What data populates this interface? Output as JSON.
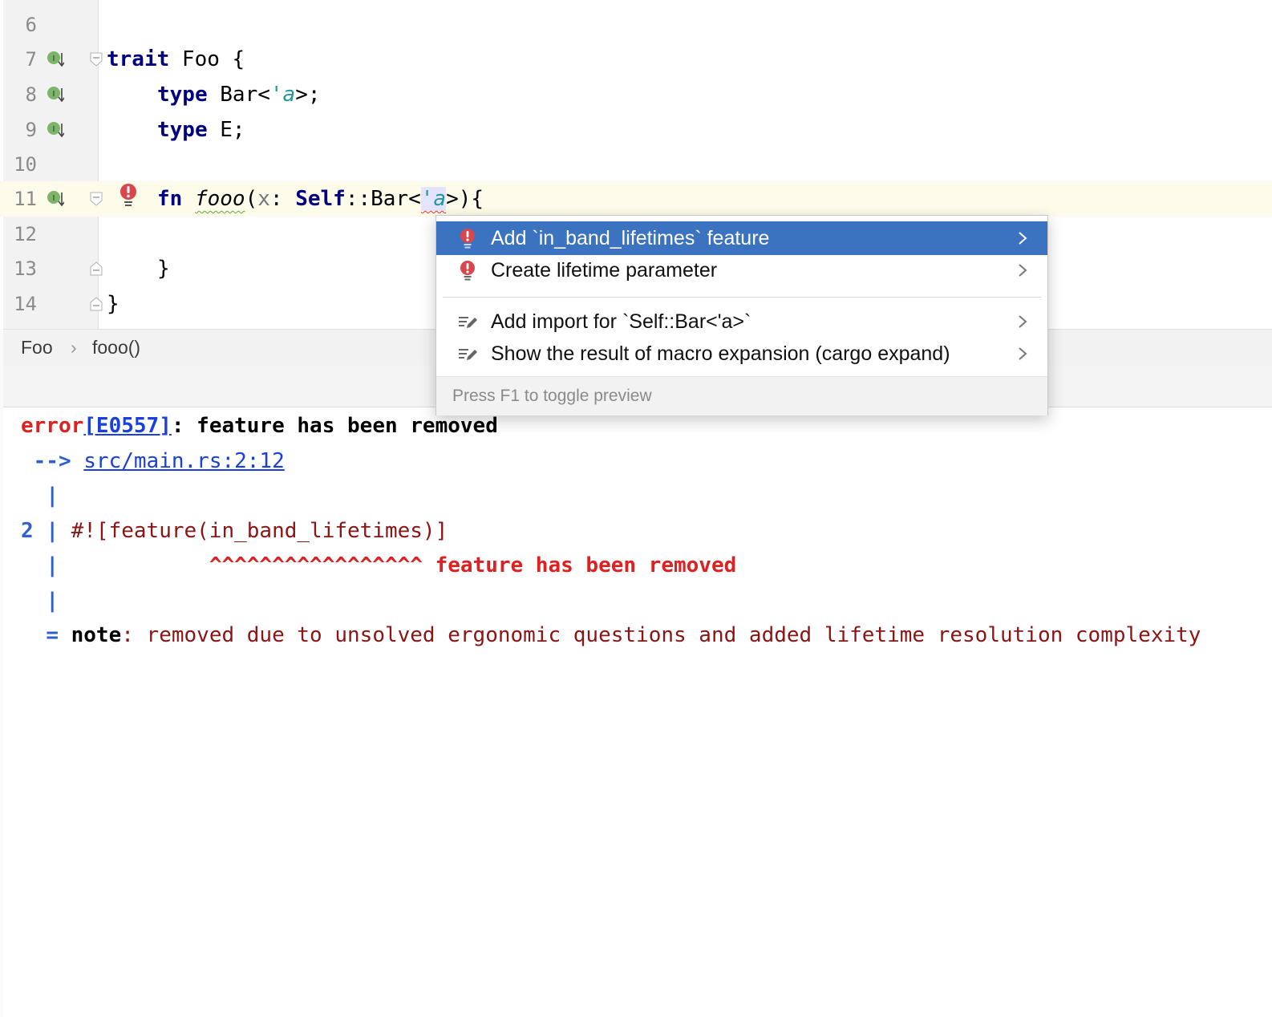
{
  "editor": {
    "lines": [
      {
        "number": "6"
      },
      {
        "number": "7",
        "code": {
          "kw": "trait",
          "rest": " Foo {"
        }
      },
      {
        "number": "8",
        "code": {
          "kw": "type",
          "p1": " Bar<",
          "lt": "'a",
          "p2": ">;"
        }
      },
      {
        "number": "9",
        "code": {
          "kw": "type",
          "rest": " E;"
        }
      },
      {
        "number": "10"
      },
      {
        "number": "11",
        "code": {
          "kw": "fn",
          "fname": "fooo",
          "p1": "(",
          "param": "x",
          "p2": ": ",
          "kw2": "Self",
          "p3": "::Bar<",
          "lt": "'a",
          "p4": ">){"
        }
      },
      {
        "number": "12"
      },
      {
        "number": "13",
        "code": {
          "rest": "}"
        }
      },
      {
        "number": "14",
        "code": {
          "rest": "}"
        }
      }
    ]
  },
  "breadcrumb": {
    "items": [
      "Foo",
      "fooo()"
    ],
    "separator": "›"
  },
  "popup": {
    "items": [
      {
        "label": "Add `in_band_lifetimes` feature",
        "icon": "error-bulb-icon",
        "selected": true
      },
      {
        "label": "Create lifetime parameter",
        "icon": "error-bulb-icon"
      },
      {
        "label": "Add import for `Self::Bar<'a>`",
        "icon": "intention-edit-icon"
      },
      {
        "label": "Show the result of macro expansion (cargo expand)",
        "icon": "intention-edit-icon"
      }
    ],
    "footer": "Press F1 to toggle preview"
  },
  "console": {
    "error_word": "error",
    "error_code": "[E0557]",
    "error_message": ": feature has been removed",
    "arrow": " -->",
    "location": "src/main.rs:2:12",
    "pipe": "|",
    "line_no": "2",
    "source_line": "#![feature(in_band_lifetimes)]",
    "carets": "^^^^^^^^^^^^^^^^^",
    "caret_message": "feature has been removed",
    "note_eq": "=",
    "note_label": "note",
    "note_text": ": removed due to unsolved ergonomic questions and added lifetime resolution complexity"
  },
  "colors": {
    "selection": "#3b73c0",
    "error": "#e02020",
    "keyword": "#000080",
    "lifetime": "#20999d",
    "link": "#1a3fe0"
  }
}
